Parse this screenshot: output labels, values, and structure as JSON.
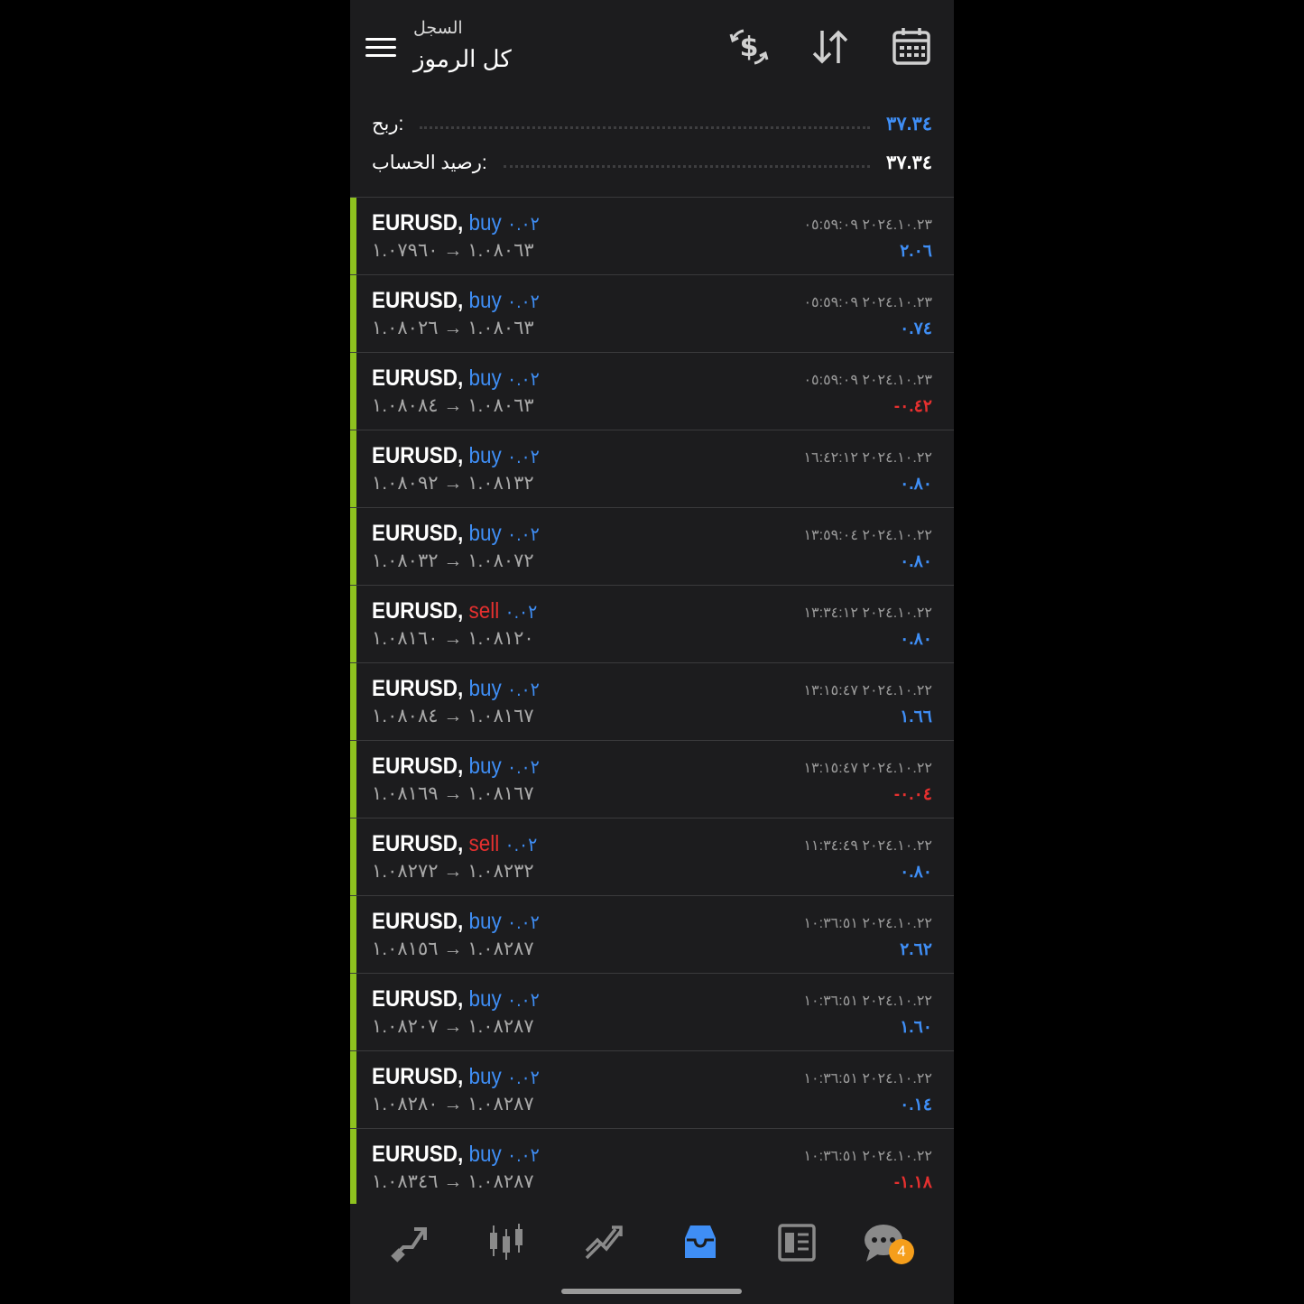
{
  "header": {
    "subtitle": "السجل",
    "title": "كل الرموز",
    "icons": [
      "menu-icon",
      "currency-exchange-icon",
      "sort-icon",
      "calendar-icon"
    ]
  },
  "summary": {
    "profit_label": "ربح:",
    "profit_value": "٣٧.٣٤",
    "balance_label": "رصيد الحساب:",
    "balance_value": "٣٧.٣٤"
  },
  "colors": {
    "buy": "#3f8ef5",
    "sell": "#e5302f",
    "indicator": "#8ec21f",
    "badge": "#f59e1b"
  },
  "deals": [
    {
      "symbol": "EURUSD,",
      "side": "buy",
      "volume": "٠.٠٢",
      "open": "١.٠٨٠٦٣",
      "close": "١.٠٧٩٦٠",
      "time": "٢٠٢٤.١٠.٢٣ ٠٥:٥٩:٠٩",
      "profit": "٢.٠٦",
      "sign": "pos"
    },
    {
      "symbol": "EURUSD,",
      "side": "buy",
      "volume": "٠.٠٢",
      "open": "١.٠٨٠٦٣",
      "close": "١.٠٨٠٢٦",
      "time": "٢٠٢٤.١٠.٢٣ ٠٥:٥٩:٠٩",
      "profit": "٠.٧٤",
      "sign": "pos"
    },
    {
      "symbol": "EURUSD,",
      "side": "buy",
      "volume": "٠.٠٢",
      "open": "١.٠٨٠٦٣",
      "close": "١.٠٨٠٨٤",
      "time": "٢٠٢٤.١٠.٢٣ ٠٥:٥٩:٠٩",
      "profit": "-٠.٤٢",
      "sign": "neg"
    },
    {
      "symbol": "EURUSD,",
      "side": "buy",
      "volume": "٠.٠٢",
      "open": "١.٠٨١٣٢",
      "close": "١.٠٨٠٩٢",
      "time": "٢٠٢٤.١٠.٢٢ ١٦:٤٢:١٢",
      "profit": "٠.٨٠",
      "sign": "pos"
    },
    {
      "symbol": "EURUSD,",
      "side": "buy",
      "volume": "٠.٠٢",
      "open": "١.٠٨٠٧٢",
      "close": "١.٠٨٠٣٢",
      "time": "٢٠٢٤.١٠.٢٢ ١٣:٥٩:٠٤",
      "profit": "٠.٨٠",
      "sign": "pos"
    },
    {
      "symbol": "EURUSD,",
      "side": "sell",
      "volume": "٠.٠٢",
      "open": "١.٠٨١٢٠",
      "close": "١.٠٨١٦٠",
      "time": "٢٠٢٤.١٠.٢٢ ١٣:٣٤:١٢",
      "profit": "٠.٨٠",
      "sign": "pos"
    },
    {
      "symbol": "EURUSD,",
      "side": "buy",
      "volume": "٠.٠٢",
      "open": "١.٠٨١٦٧",
      "close": "١.٠٨٠٨٤",
      "time": "٢٠٢٤.١٠.٢٢ ١٣:١٥:٤٧",
      "profit": "١.٦٦",
      "sign": "pos"
    },
    {
      "symbol": "EURUSD,",
      "side": "buy",
      "volume": "٠.٠٢",
      "open": "١.٠٨١٦٧",
      "close": "١.٠٨١٦٩",
      "time": "٢٠٢٤.١٠.٢٢ ١٣:١٥:٤٧",
      "profit": "-٠.٠٤",
      "sign": "neg"
    },
    {
      "symbol": "EURUSD,",
      "side": "sell",
      "volume": "٠.٠٢",
      "open": "١.٠٨٢٣٢",
      "close": "١.٠٨٢٧٢",
      "time": "٢٠٢٤.١٠.٢٢ ١١:٣٤:٤٩",
      "profit": "٠.٨٠",
      "sign": "pos"
    },
    {
      "symbol": "EURUSD,",
      "side": "buy",
      "volume": "٠.٠٢",
      "open": "١.٠٨٢٨٧",
      "close": "١.٠٨١٥٦",
      "time": "٢٠٢٤.١٠.٢٢ ١٠:٣٦:٥١",
      "profit": "٢.٦٢",
      "sign": "pos"
    },
    {
      "symbol": "EURUSD,",
      "side": "buy",
      "volume": "٠.٠٢",
      "open": "١.٠٨٢٨٧",
      "close": "١.٠٨٢٠٧",
      "time": "٢٠٢٤.١٠.٢٢ ١٠:٣٦:٥١",
      "profit": "١.٦٠",
      "sign": "pos"
    },
    {
      "symbol": "EURUSD,",
      "side": "buy",
      "volume": "٠.٠٢",
      "open": "١.٠٨٢٨٧",
      "close": "١.٠٨٢٨٠",
      "time": "٢٠٢٤.١٠.٢٢ ١٠:٣٦:٥١",
      "profit": "٠.١٤",
      "sign": "pos"
    },
    {
      "symbol": "EURUSD,",
      "side": "buy",
      "volume": "٠.٠٢",
      "open": "١.٠٨٢٨٧",
      "close": "١.٠٨٣٤٦",
      "time": "٢٠٢٤.١٠.٢٢ ١٠:٣٦:٥١",
      "profit": "-١.١٨",
      "sign": "neg"
    }
  ],
  "tabbar": {
    "tabs": [
      "trade-icon",
      "quotes-icon",
      "chart-icon",
      "history-icon",
      "news-icon",
      "chat-icon"
    ],
    "active": "history-icon",
    "chat_badge": "4"
  }
}
